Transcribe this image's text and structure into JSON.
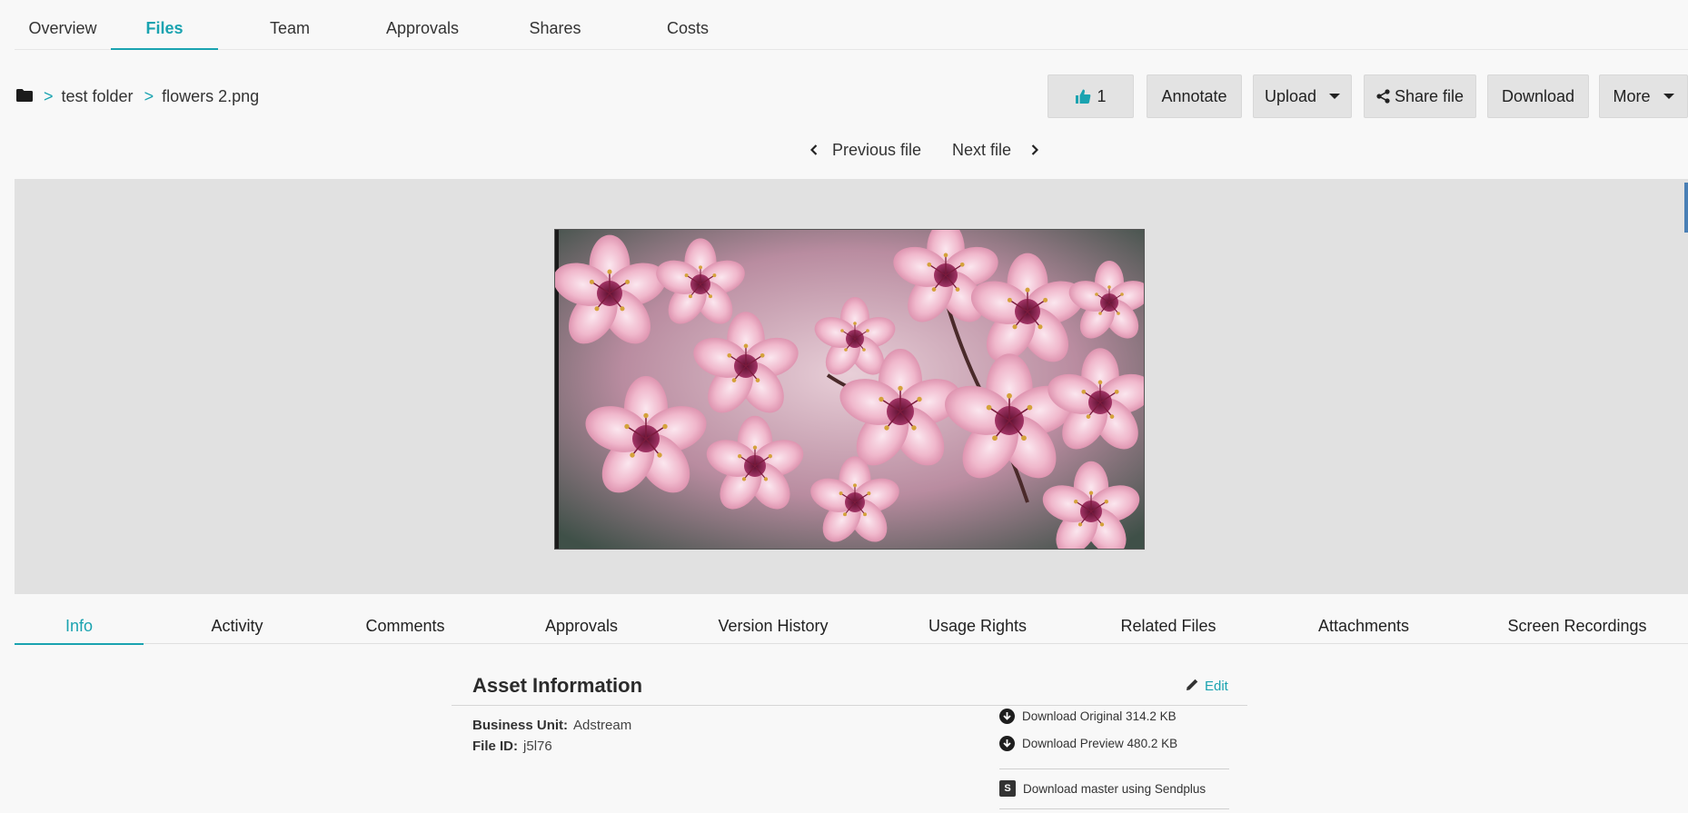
{
  "top_nav": {
    "tabs": [
      {
        "label": "Overview",
        "active": false
      },
      {
        "label": "Files",
        "active": true
      },
      {
        "label": "Team",
        "active": false
      },
      {
        "label": "Approvals",
        "active": false
      },
      {
        "label": "Shares",
        "active": false
      },
      {
        "label": "Costs",
        "active": false
      }
    ]
  },
  "breadcrumb": {
    "icon": "folder-icon",
    "separator": ">",
    "items": [
      "test folder",
      "flowers 2.png"
    ]
  },
  "toolbar": {
    "like_count": "1",
    "annotate_label": "Annotate",
    "upload_label": "Upload",
    "share_label": "Share file",
    "download_label": "Download",
    "more_label": "More"
  },
  "file_nav": {
    "previous_label": "Previous file",
    "next_label": "Next file"
  },
  "sub_tabs": {
    "tabs": [
      {
        "label": "Info",
        "active": true
      },
      {
        "label": "Activity",
        "active": false
      },
      {
        "label": "Comments",
        "active": false
      },
      {
        "label": "Approvals",
        "active": false
      },
      {
        "label": "Version History",
        "active": false
      },
      {
        "label": "Usage Rights",
        "active": false
      },
      {
        "label": "Related Files",
        "active": false
      },
      {
        "label": "Attachments",
        "active": false
      },
      {
        "label": "Screen Recordings",
        "active": false
      }
    ]
  },
  "asset_info": {
    "title": "Asset Information",
    "edit_label": "Edit",
    "fields": [
      {
        "label": "Business Unit:",
        "value": "Adstream"
      },
      {
        "label": "File ID:",
        "value": "j5l76"
      }
    ],
    "downloads": [
      "Download Original 314.2 KB",
      "Download Preview 480.2 KB"
    ],
    "sendplus_label": "Download master using Sendplus"
  },
  "colors": {
    "accent": "#1aa3b0",
    "preview_bg": "#e1e1e1",
    "button_bg": "#e3e3e3"
  }
}
